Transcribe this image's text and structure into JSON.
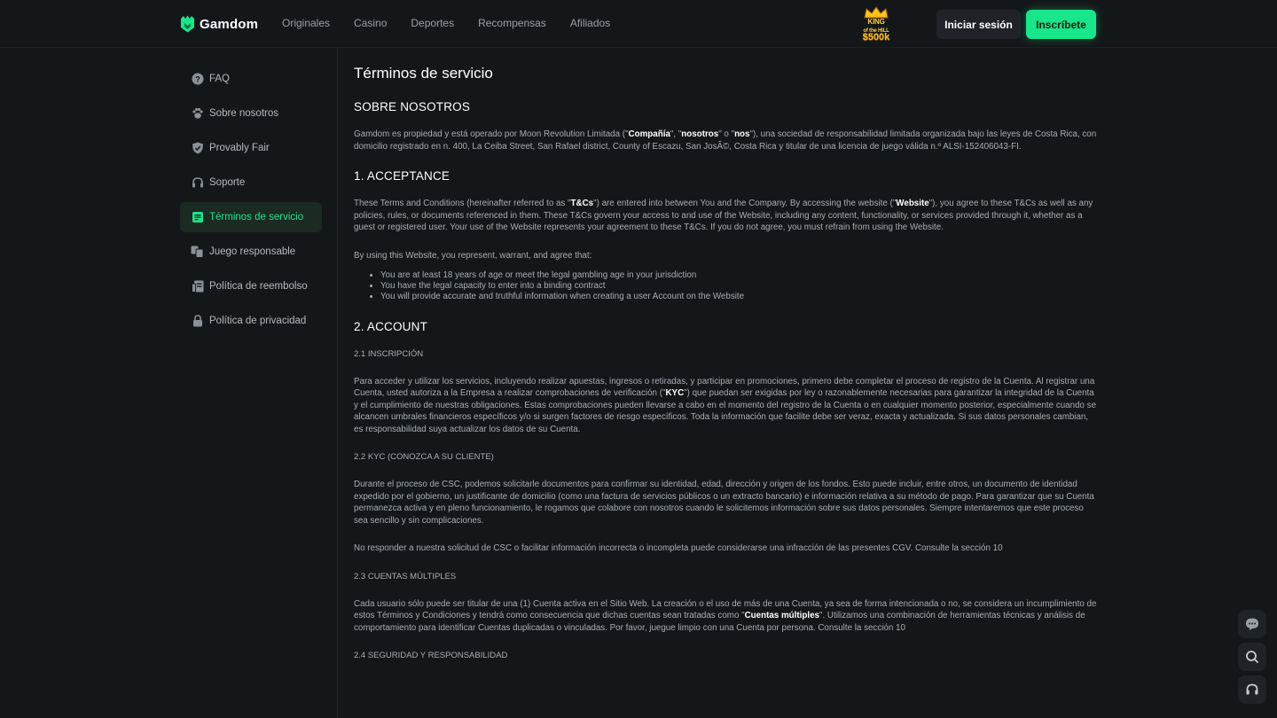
{
  "header": {
    "logo_text": "Gamdom",
    "nav": [
      "Originales",
      "Casino",
      "Deportes",
      "Recompensas",
      "Afiliados"
    ],
    "promo": {
      "line1": "KING",
      "line2": "of the HILL",
      "amount": "$500k"
    },
    "login_label": "Iniciar sesión",
    "signup_label": "Inscríbete",
    "accent_color": "#17e68a"
  },
  "sidebar": {
    "items": [
      {
        "label": "FAQ",
        "icon": "question-icon"
      },
      {
        "label": "Sobre nosotros",
        "icon": "paw-icon"
      },
      {
        "label": "Provably Fair",
        "icon": "shield-check-icon"
      },
      {
        "label": "Soporte",
        "icon": "headset-icon"
      },
      {
        "label": "Términos de servicio",
        "icon": "document-icon",
        "active": true
      },
      {
        "label": "Juego responsable",
        "icon": "cards-icon"
      },
      {
        "label": "Política de reembolso",
        "icon": "refund-icon"
      },
      {
        "label": "Política de privacidad",
        "icon": "lock-icon"
      }
    ]
  },
  "content": {
    "title": "Términos de servicio",
    "about": {
      "heading": "SOBRE NOSOTROS",
      "p1": "Gamdom es propiedad y está operado por Moon Revolution Limitada (\"",
      "p1_b1": "Compañía",
      "p1_m1": "\", \"",
      "p1_b2": "nosotros",
      "p1_m2": "\" o \"",
      "p1_b3": "nos",
      "p1_rest": "\"), una sociedad de responsabilidad limitada organizada bajo las leyes de Costa Rica, con domicilio registrado en n. 400, La Ceiba Street, San Rafael district, County of Escazu, San JosÃ©, Costa Rica y titular de una licencia de juego válida n.º ALSI-152406043-FI."
    },
    "acceptance": {
      "heading": "1. ACCEPTANCE",
      "p1_a": "These Terms and Conditions (hereinafter referred to as \"",
      "p1_b1": "T&Cs",
      "p1_m": "\") are entered into between You and the Company. By accessing the website (\"",
      "p1_b2": "Website",
      "p1_rest": "\"), you agree to these T&Cs as well as any policies, rules, or documents referenced in them. These T&Cs govern your access to and use of the Website, including any content, functionality, or services provided through it, whether as a guest or registered user. Your use of the Website represents your agreement to these T&Cs. If you do not agree, you must refrain from using the Website.",
      "p2": "By using this Website, you represent, warrant, and agree that:",
      "bullets": [
        "You are at least 18 years of age or meet the legal gambling age in your jurisdiction",
        "You have the legal capacity to enter into a binding contract",
        "You will provide accurate and truthful information when creating a user Account on the Website"
      ]
    },
    "account": {
      "heading": "2. ACCOUNT",
      "s21": "2.1 INSCRIPCIÓN",
      "s21_p_a": "Para acceder y utilizar los servicios, incluyendo realizar apuestas, ingresos o retiradas, y participar en promociones, primero debe completar el proceso de registro de la Cuenta. Al registrar una Cuenta, usted autoriza a la Empresa a realizar comprobaciones de verificación (\"",
      "s21_p_b": "KYC",
      "s21_p_rest": "\") que puedan ser exigidas por ley o razonablemente necesarias para garantizar la integridad de la Cuenta y el cumplimiento de nuestras obligaciones. Estas comprobaciones pueden llevarse a cabo en el momento del registro de la Cuenta o en cualquier momento posterior, especialmente cuando se alcancen umbrales financieros específicos y/o si surgen factores de riesgo específicos. Toda la información que facilite debe ser veraz, exacta y actualizada. Si sus datos personales cambian, es responsabilidad suya actualizar los datos de su Cuenta.",
      "s22": "2.2 KYC (CONOZCA A SU CLIENTE)",
      "s22_p1": "Durante el proceso de CSC, podemos solicitarle documentos para confirmar su identidad, edad, dirección y origen de los fondos. Esto puede incluir, entre otros, un documento de identidad expedido por el gobierno, un justificante de domicilio (como una factura de servicios públicos o un extracto bancario) e información relativa a su método de pago. Para garantizar que su Cuenta permanezca activa y en pleno funcionamiento, le rogamos que colabore con nosotros cuando le solicitemos información sobre sus datos personales. Siempre intentaremos que este proceso sea sencillo y sin complicaciones.",
      "s22_p2": "No responder a nuestra solicitud de CSC o facilitar información incorrecta o incompleta puede considerarse una infracción de las presentes CGV. Consulte la sección 10",
      "s23": "2.3 CUENTAS MÚLTIPLES",
      "s23_p_a": "Cada usuario sólo puede ser titular de una (1) Cuenta activa en el Sitio Web. La creación o el uso de más de una Cuenta, ya sea de forma intencionada o no, se considera un incumplimiento de estos Términos y Condiciones y tendrá como consecuencia que dichas cuentas sean tratadas como \"",
      "s23_p_b": "Cuentas múltiples",
      "s23_p_rest": "\". Utilizamos una combinación de herramientas técnicas y análisis de comportamiento para identificar Cuentas duplicadas o vinculadas. Por favor, juegue limpio con una Cuenta por persona. Consulte la sección 10",
      "s24": "2.4 SEGURIDAD Y RESPONSABILIDAD"
    }
  },
  "floating": [
    "chat-icon",
    "search-icon",
    "headset-icon"
  ]
}
